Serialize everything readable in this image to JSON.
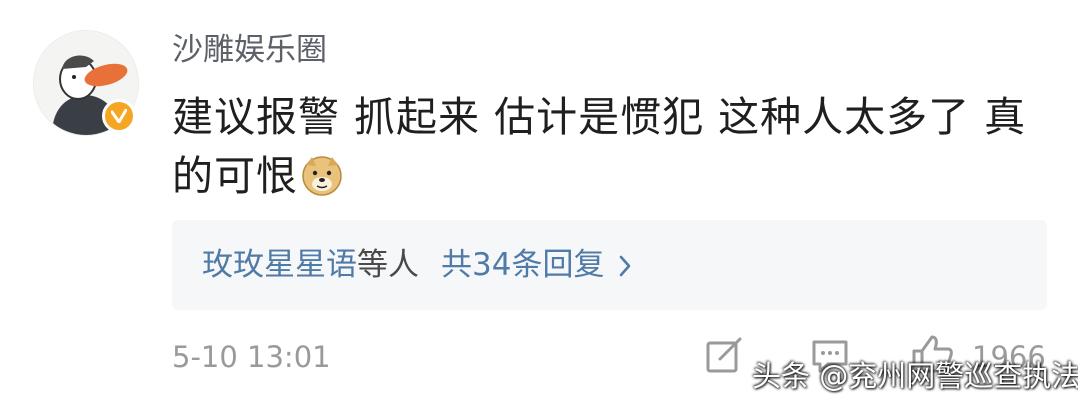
{
  "comment": {
    "username": "沙雕娱乐圈",
    "verified_icon": "verified-badge-icon",
    "text": "建议报警 抓起来 估计是惯犯 这种人太多了 真的可恨",
    "emoji": "doge-emoji-icon",
    "replies": {
      "names": "玫玫星星语",
      "etc": "等人",
      "count": "共34条回复"
    },
    "timestamp": "5-10 13:01",
    "likes": "1966"
  },
  "watermark": "头条 @兖州网警巡查执法",
  "colors": {
    "username": "#5d6068",
    "link": "#517ba7",
    "meta": "#9a9a9a",
    "verified": "#f5a623",
    "reply_bg": "#f6f7f9"
  }
}
